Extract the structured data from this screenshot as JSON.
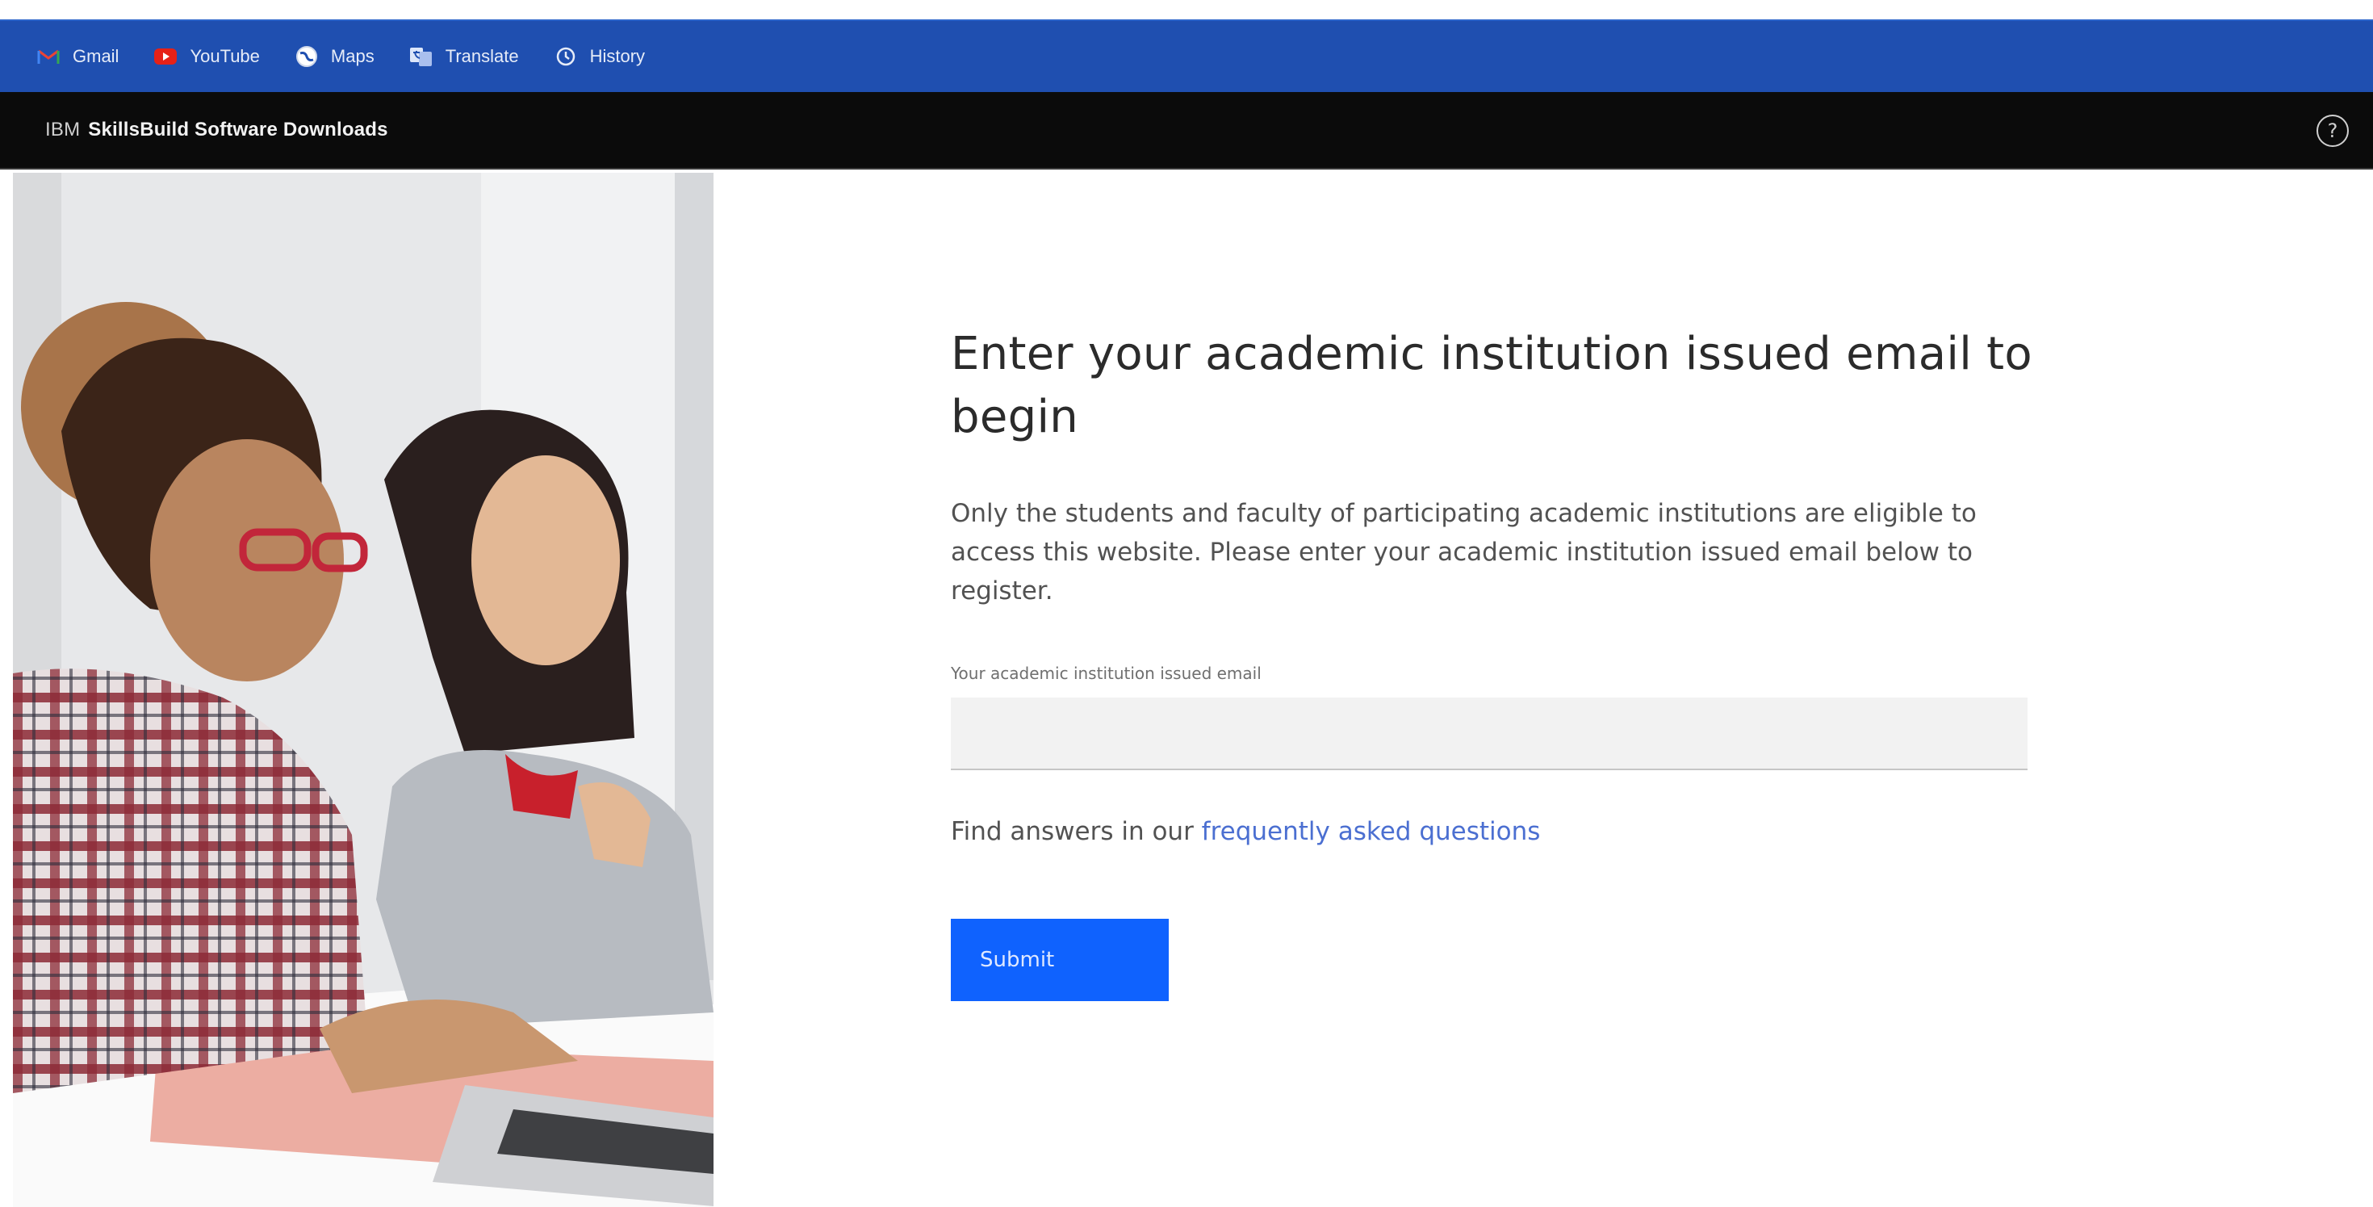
{
  "bookmarks": [
    {
      "label": "Gmail",
      "icon": "gmail-icon"
    },
    {
      "label": "YouTube",
      "icon": "youtube-icon"
    },
    {
      "label": "Maps",
      "icon": "maps-icon"
    },
    {
      "label": "Translate",
      "icon": "translate-icon"
    },
    {
      "label": "History",
      "icon": "history-icon"
    }
  ],
  "header": {
    "brand": "IBM",
    "product": "SkillsBuild Software Downloads",
    "help_icon": "?"
  },
  "main": {
    "title": "Enter your academic institution issued email to begin",
    "description": "Only the students and faculty of participating academic institutions are eligible to access this website. Please enter your academic institution issued email below to register.",
    "email_label": "Your academic institution issued email",
    "email_value": "",
    "email_placeholder": "",
    "faq_prefix": "Find answers in our ",
    "faq_link": "frequently asked questions",
    "submit_label": "Submit"
  },
  "colors": {
    "bookmarks_bar": "#1f4fb0",
    "header_bg": "#0b0b0b",
    "primary_button": "#0f62fe",
    "link": "#4b6fd1"
  }
}
